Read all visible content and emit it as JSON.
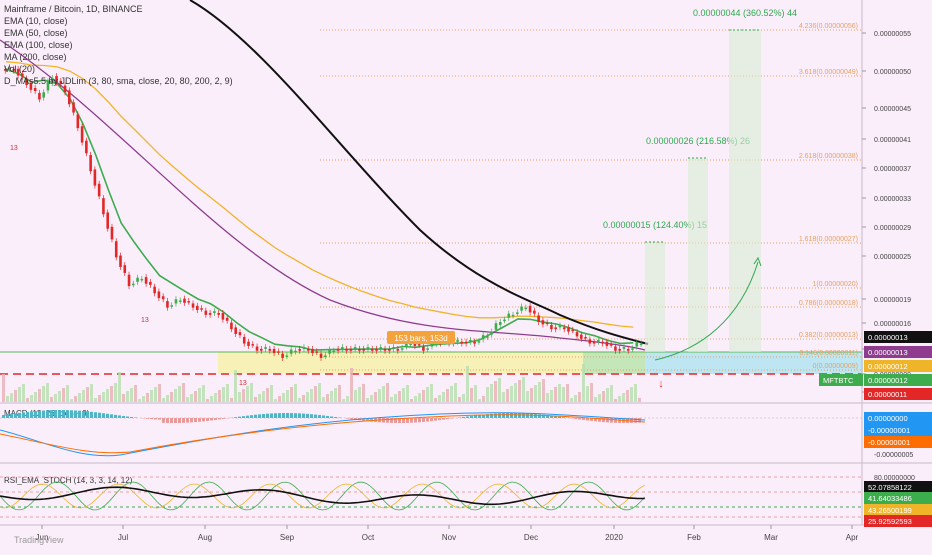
{
  "header": {
    "symbol_line": "Mainframe / Bitcoin, 1D, BINANCE",
    "indicators": [
      "EMA (10, close)",
      "EMA (50, close)",
      "EMA (100, close)",
      "MA (200, close)",
      "Vol (20)",
      "D_MAs5.5 by JDLim (3, 80, sma, close, 20, 80, 200, 2, 9)"
    ]
  },
  "colors": {
    "background": "#fbeefb",
    "ema10": "#3dac4d",
    "ema50": "#f0b429",
    "ema100": "#8e3d8e",
    "ma200": "#111111",
    "up": "#26a69a",
    "down": "#e32727",
    "target": "#2fa84f",
    "fib": "#e8a060",
    "zone_blue": "#aee3f0",
    "zone_yellow": "#f5f0a0"
  },
  "chart_data": [
    {
      "type": "candlestick",
      "title": "Mainframe / Bitcoin, 1D, BINANCE",
      "x_ticks": [
        "Jun",
        "Jul",
        "Aug",
        "Sep",
        "Oct",
        "Nov",
        "Dec",
        "2020",
        "Feb",
        "Mar",
        "Apr"
      ],
      "y_ticks": [
        "0.00000055",
        "0.00000050",
        "0.00000045",
        "0.00000041",
        "0.00000037",
        "0.00000033",
        "0.00000029",
        "0.00000025",
        "0.00000019",
        "0.00000016",
        "0.00000012",
        "0.00000009",
        "0.00000005"
      ],
      "close_series": [
        5e-07,
        4.8e-07,
        4.6e-07,
        4.9e-07,
        4.7e-07,
        4.2e-07,
        3.6e-07,
        3e-07,
        2.4e-07,
        2e-07,
        2.1e-07,
        1.9e-07,
        1.7e-07,
        1.8e-07,
        1.7e-07,
        1.6e-07,
        1.6e-07,
        1.4e-07,
        1.2e-07,
        1.1e-07,
        1.1e-07,
        1e-07,
        1.1e-07,
        1.1e-07,
        1e-07,
        1.1e-07,
        1.1e-07,
        1.1e-07,
        1.1e-07,
        1.1e-07,
        1.1e-07,
        1.2e-07,
        1.1e-07,
        1.2e-07,
        1.2e-07,
        1.2e-07,
        1.2e-07,
        1.3e-07,
        1.5e-07,
        1.6e-07,
        1.7e-07,
        1.5e-07,
        1.4e-07,
        1.4e-07,
        1.3e-07,
        1.2e-07,
        1.2e-07,
        1.1e-07,
        1.1e-07,
        1.2e-07
      ],
      "price_labels": [
        {
          "text": "0.00000013",
          "color": "#111111"
        },
        {
          "text": "0.00000013",
          "color": "#8e3d8e"
        },
        {
          "text": "0.00000012",
          "color": "#f0b429"
        },
        {
          "text": "MFTBTC",
          "color": "#3dac4d"
        },
        {
          "text": "0.00000012",
          "color": "#3dac4d"
        },
        {
          "text": "0.00000011",
          "color": "#e32727"
        }
      ],
      "fib_levels": [
        "4.236(0.00000056)",
        "3.618(0.00000049)",
        "2.618(0.00000038)",
        "1.618(0.00000027)",
        "1(0.00000020)",
        "0.786(0.00000018)",
        "0.382(0.00000013)",
        "0.146(0.00000011)",
        "0(0.00000009)"
      ],
      "targets": [
        {
          "label": "0.00000015 (124.40%) 15"
        },
        {
          "label": "0.00000026 (216.58%) 26"
        },
        {
          "label": "0.00000044 (360.52%) 44"
        }
      ],
      "range_annotation": "153 bars, 153d",
      "signal_labels": [
        "13",
        "13",
        "13"
      ]
    },
    {
      "type": "histogram",
      "title": "MACD (12, 26, close, 9)",
      "y_ticks": [
        "0.00000000",
        "-0.00000005"
      ],
      "price_labels": [
        {
          "text": "0.00000000",
          "color": "#2196f3"
        },
        {
          "text": "-0.00000001",
          "color": "#2196f3"
        },
        {
          "text": "-0.00000001",
          "color": "#ff6d00"
        }
      ]
    },
    {
      "type": "line",
      "title": "RSI_EMA_STOCH (14, 3, 3, 14, 12)",
      "y_ticks": [
        "80.00000000",
        "20.00000000"
      ],
      "price_labels": [
        {
          "text": "52.07858122",
          "color": "#111111"
        },
        {
          "text": "41.64033486",
          "color": "#3dac4d"
        },
        {
          "text": "43.26500199",
          "color": "#f0b429"
        },
        {
          "text": "25.92592593",
          "color": "#e32727"
        }
      ]
    }
  ],
  "footer": {
    "watermark": "TradingView"
  }
}
